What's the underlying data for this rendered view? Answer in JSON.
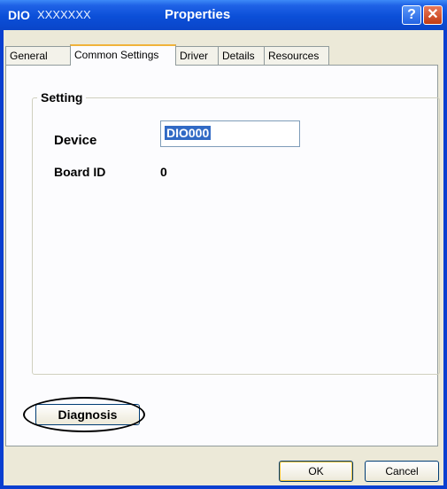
{
  "window": {
    "title_prefix": "DIO",
    "title_device": "XXXXXXX",
    "title": "Properties",
    "help_glyph": "?",
    "close_glyph": "✕"
  },
  "tabs": [
    {
      "label": "General",
      "active": false
    },
    {
      "label": "Common Settings",
      "active": true
    },
    {
      "label": "Driver",
      "active": false
    },
    {
      "label": "Details",
      "active": false
    },
    {
      "label": "Resources",
      "active": false
    }
  ],
  "setting": {
    "group_label": "Setting",
    "device_label": "Device",
    "device_value": "DIO000",
    "board_id_label": "Board ID",
    "board_id_value": "0"
  },
  "buttons": {
    "diagnosis": "Diagnosis",
    "ok": "OK",
    "cancel": "Cancel"
  },
  "colors": {
    "titlebar": "#0a45c8",
    "selection": "#316ac5",
    "active_tab_accent": "#f0b33a"
  }
}
